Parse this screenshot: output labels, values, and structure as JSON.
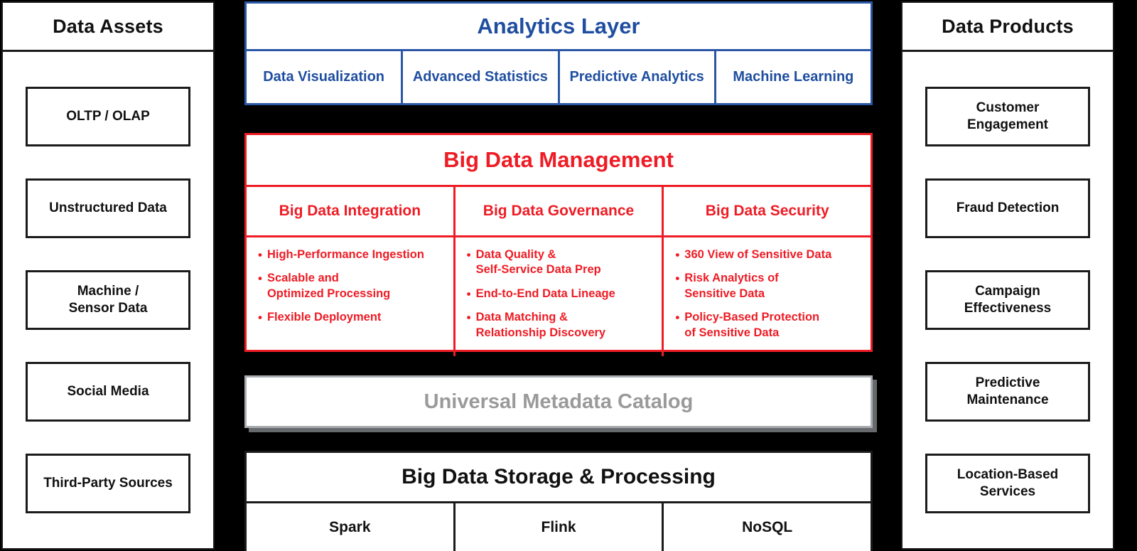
{
  "colors": {
    "background": "#000000",
    "blue": "#1f4ea0",
    "red": "#ee1c25",
    "grey": "#9a9a9a",
    "black": "#111111"
  },
  "left_column": {
    "header": "Data Assets",
    "items": [
      {
        "label": "OLTP / OLAP"
      },
      {
        "label": "Unstructured Data"
      },
      {
        "label": "Machine /\nSensor Data"
      },
      {
        "label": "Social Media"
      },
      {
        "label": "Third-Party Sources"
      }
    ]
  },
  "right_column": {
    "header": "Data Products",
    "items": [
      {
        "label": "Customer\nEngagement"
      },
      {
        "label": "Fraud Detection"
      },
      {
        "label": "Campaign\nEffectiveness"
      },
      {
        "label": "Predictive\nMaintenance"
      },
      {
        "label": "Location-Based\nServices"
      }
    ]
  },
  "analytics_layer": {
    "title": "Analytics Layer",
    "cells": [
      {
        "label": "Data Visualization"
      },
      {
        "label": "Advanced Statistics"
      },
      {
        "label": "Predictive Analytics"
      },
      {
        "label": "Machine Learning"
      }
    ]
  },
  "big_data_management": {
    "title": "Big Data Management",
    "columns": [
      {
        "heading": "Big Data Integration",
        "bullets": [
          "High-Performance Ingestion",
          "Scalable and\nOptimized Processing",
          "Flexible Deployment"
        ]
      },
      {
        "heading": "Big Data Governance",
        "bullets": [
          "Data Quality &\nSelf-Service Data Prep",
          "End-to-End Data Lineage",
          "Data Matching &\nRelationship Discovery"
        ]
      },
      {
        "heading": "Big Data Security",
        "bullets": [
          "360 View of Sensitive Data",
          "Risk Analytics of\nSensitive Data",
          "Policy-Based Protection\nof Sensitive Data"
        ]
      }
    ]
  },
  "metadata_catalog": {
    "title": "Universal Metadata Catalog"
  },
  "storage_layer": {
    "title": "Big Data Storage & Processing",
    "cells": [
      {
        "label": "Spark"
      },
      {
        "label": "Flink"
      },
      {
        "label": "NoSQL"
      }
    ]
  }
}
